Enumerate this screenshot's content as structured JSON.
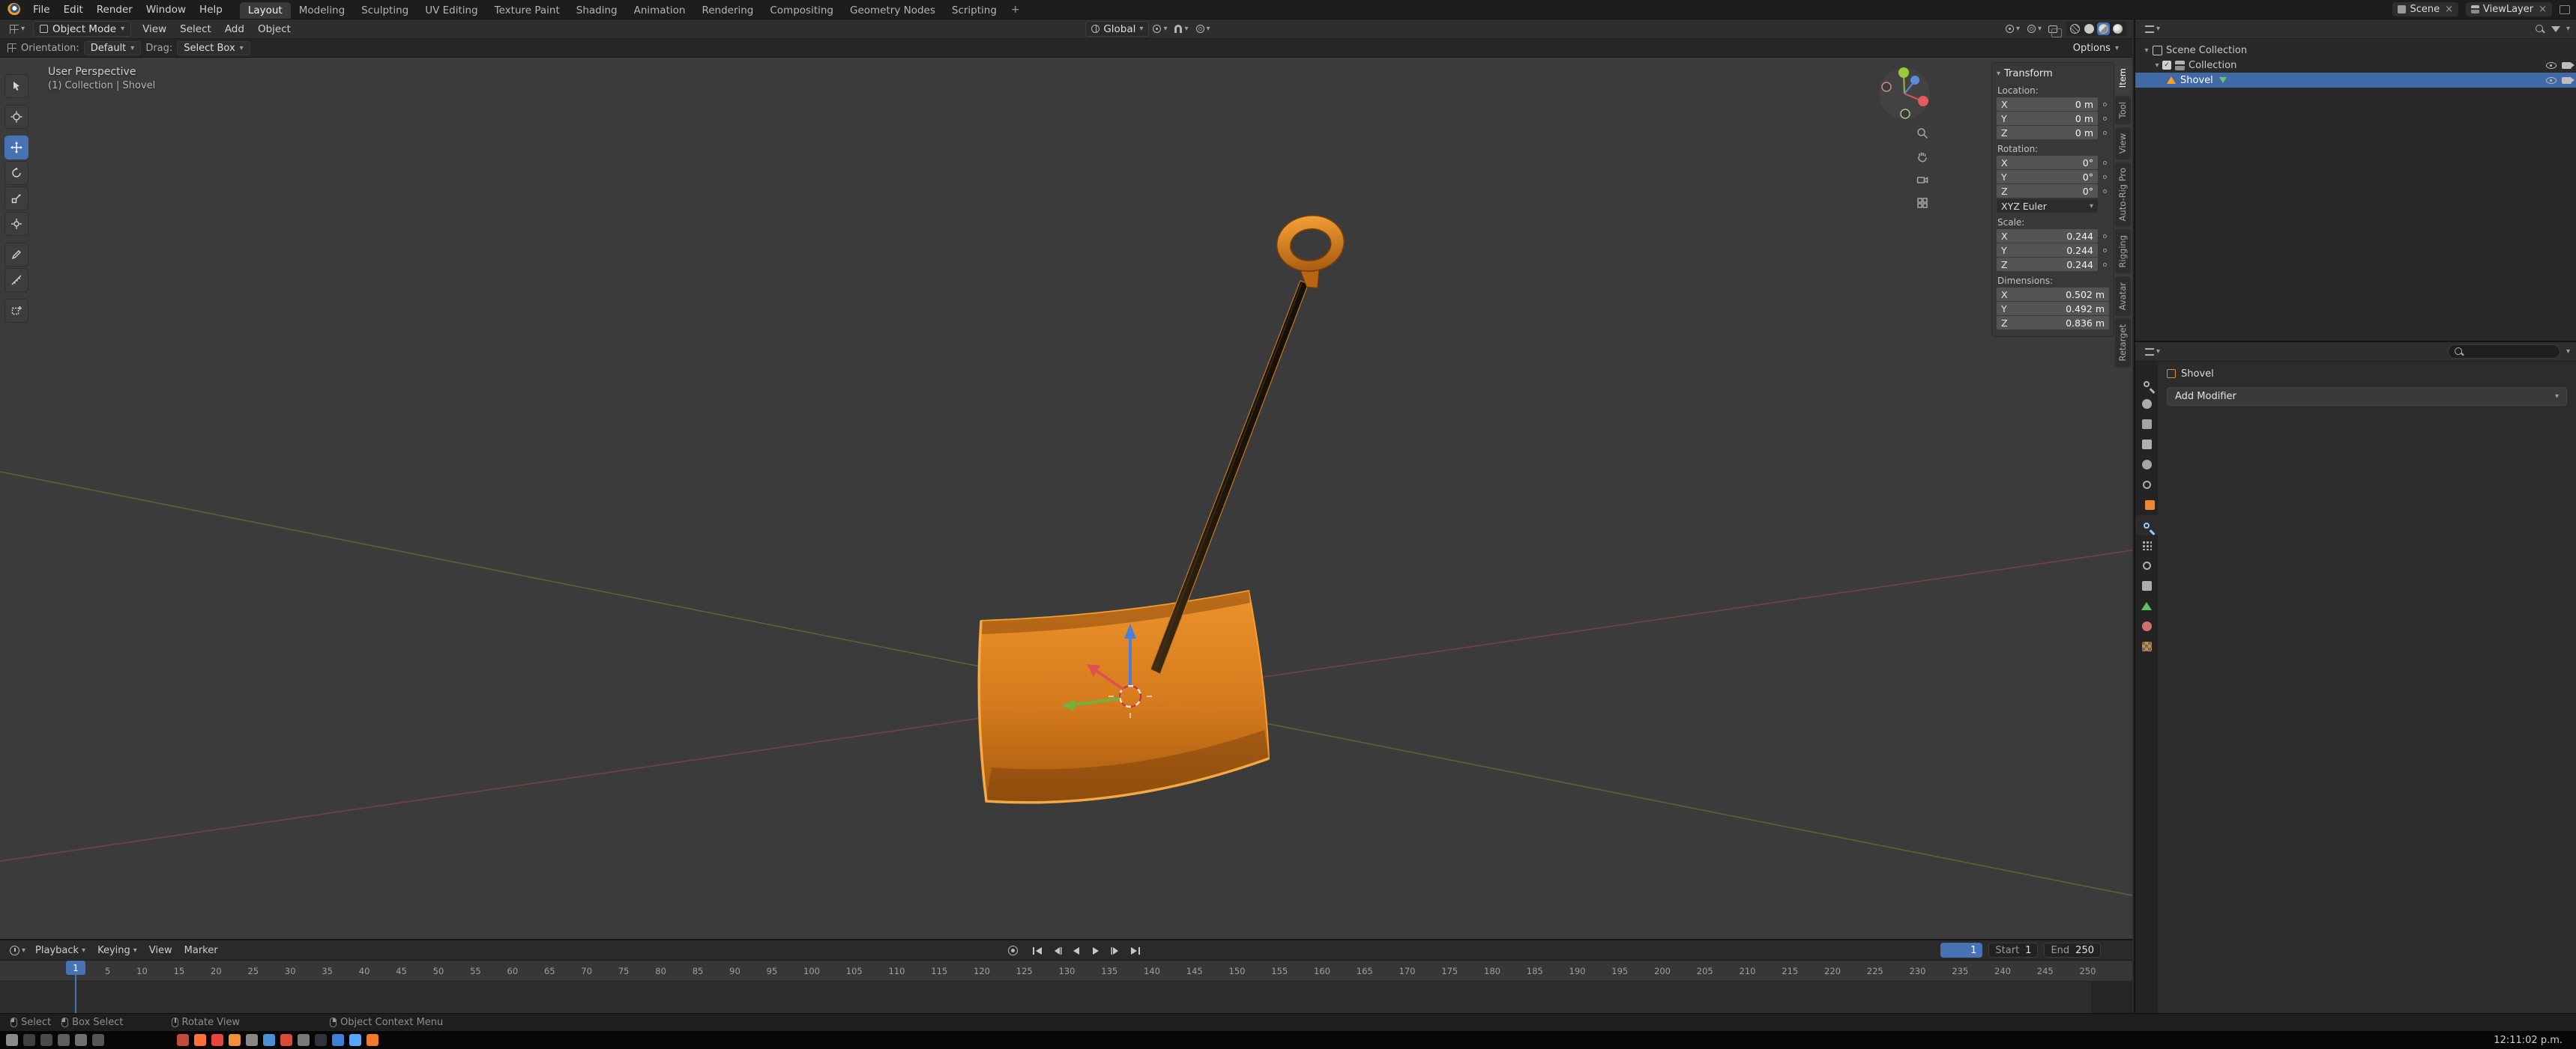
{
  "topbar": {
    "menus": [
      "File",
      "Edit",
      "Render",
      "Window",
      "Help"
    ],
    "workspaces": [
      {
        "label": "Layout",
        "active": true
      },
      {
        "label": "Modeling"
      },
      {
        "label": "Sculpting"
      },
      {
        "label": "UV Editing"
      },
      {
        "label": "Texture Paint"
      },
      {
        "label": "Shading"
      },
      {
        "label": "Animation"
      },
      {
        "label": "Rendering"
      },
      {
        "label": "Compositing"
      },
      {
        "label": "Geometry Nodes"
      },
      {
        "label": "Scripting"
      }
    ],
    "add_workspace": "+",
    "scene": "Scene",
    "view_layer": "ViewLayer"
  },
  "viewport_header": {
    "mode": "Object Mode",
    "menus": [
      "View",
      "Select",
      "Add",
      "Object"
    ],
    "orientation": "Global",
    "shading_modes": [
      "Wireframe",
      "Solid",
      "Material Preview",
      "Rendered"
    ],
    "active_shading": "Material Preview"
  },
  "tool_settings": {
    "orientation_label": "Orientation:",
    "orientation_value": "Default",
    "drag_label": "Drag:",
    "drag_value": "Select Box",
    "options_label": "Options"
  },
  "tools": [
    "Select Box",
    "Cursor",
    "Move",
    "Rotate",
    "Scale",
    "Transform",
    "Annotate",
    "Measure",
    "Add Cube"
  ],
  "active_tool": "Move",
  "viewport": {
    "view_label": "User Perspective",
    "context_label": "(1) Collection | Shovel",
    "accent_orange": "#e8871e",
    "axis_colors": {
      "x": "#e05252",
      "y": "#6fb33c",
      "z": "#4a7fe0"
    }
  },
  "n_panel": {
    "title": "Transform",
    "axes": [
      "X",
      "Y",
      "Z"
    ],
    "tabs": [
      {
        "label": "Item",
        "active": true
      },
      {
        "label": "Tool"
      },
      {
        "label": "View"
      },
      {
        "label": "Auto-Rig Pro"
      },
      {
        "label": "Rigging"
      },
      {
        "label": "Avatar"
      },
      {
        "label": "Retarget"
      }
    ],
    "location": {
      "label": "Location:",
      "x": "0 m",
      "y": "0 m",
      "z": "0 m"
    },
    "rotation": {
      "label": "Rotation:",
      "x": "0°",
      "y": "0°",
      "z": "0°",
      "mode": "XYZ Euler"
    },
    "scale": {
      "label": "Scale:",
      "x": "0.244",
      "y": "0.244",
      "z": "0.244"
    },
    "dimensions": {
      "label": "Dimensions:",
      "x": "0.502 m",
      "y": "0.492 m",
      "z": "0.836 m"
    }
  },
  "outliner": {
    "rows": [
      {
        "label": "Scene Collection"
      },
      {
        "label": "Collection"
      },
      {
        "label": "Shovel",
        "selected": true
      }
    ]
  },
  "properties": {
    "breadcrumb_object": "Shovel",
    "add_modifier_label": "Add Modifier",
    "active_tab": "modifiers",
    "tabs": [
      {
        "name": "tool",
        "shape": "wrench",
        "color": "#b3b3b3"
      },
      {
        "name": "render",
        "shape": "circle",
        "color": "#adadad"
      },
      {
        "name": "output",
        "shape": "square",
        "color": "#a5a5a5"
      },
      {
        "name": "view-layer",
        "shape": "square",
        "color": "#b0b0b0"
      },
      {
        "name": "scene",
        "shape": "circle",
        "color": "#a5a5a5"
      },
      {
        "name": "world",
        "shape": "ring",
        "color": "#adadad"
      },
      {
        "name": "object",
        "shape": "square",
        "color": "#e8883a",
        "gap": 8
      },
      {
        "name": "modifiers",
        "shape": "wrench",
        "color": "#9ecbff",
        "active": true
      },
      {
        "name": "particles",
        "shape": "dots",
        "color": "#b0b0b0"
      },
      {
        "name": "physics",
        "shape": "ring",
        "color": "#b0b0b0"
      },
      {
        "name": "constraints",
        "shape": "square",
        "color": "#adadad"
      },
      {
        "name": "object-data",
        "shape": "triangle",
        "color": "#5fbf5f"
      },
      {
        "name": "material",
        "shape": "circle",
        "color": "#cf7070"
      },
      {
        "name": "texture",
        "shape": "checker",
        "color": "#d08a3a"
      }
    ]
  },
  "timeline": {
    "menus_popover": [
      "Playback",
      "Keying"
    ],
    "menus_plain": [
      "View",
      "Marker"
    ],
    "current_frame": "1",
    "start_label": "Start",
    "start_value": "1",
    "end_label": "End",
    "end_value": "250",
    "frame_labels": [
      5,
      10,
      15,
      20,
      25,
      30,
      35,
      40,
      45,
      50,
      55,
      60,
      65,
      70,
      75,
      80,
      85,
      90,
      95,
      100,
      105,
      110,
      115,
      120,
      125,
      130,
      135,
      140,
      145,
      150,
      155,
      160,
      165,
      170,
      175,
      180,
      185,
      190,
      195,
      200,
      205,
      210,
      215,
      220,
      225,
      230,
      235,
      240,
      245,
      250
    ]
  },
  "status_bar": {
    "items": [
      {
        "label": "Select",
        "mouse": "l",
        "gap": 0
      },
      {
        "label": "Box Select",
        "mouse": "l",
        "gap": 14
      },
      {
        "label": "Rotate View",
        "mouse": "m",
        "gap": 64
      },
      {
        "label": "Object Context Menu",
        "mouse": "r",
        "gap": 120
      }
    ]
  },
  "taskbar": {
    "clock": "12:11:02 p.m.",
    "icons": [
      {
        "name": "app-menu",
        "color": "#8a8a8a"
      },
      {
        "name": "terminal",
        "color": "#3f3f3f"
      },
      {
        "name": "console",
        "color": "#4a4a4a"
      },
      {
        "name": "files",
        "color": "#5f5f5f"
      },
      {
        "name": "settings",
        "color": "#6f6f6f"
      },
      {
        "name": "editor",
        "color": "#555555"
      },
      {
        "name": "app-red",
        "color": "#c24a3a",
        "gap": 90
      },
      {
        "name": "firefox",
        "color": "#ff7139"
      },
      {
        "name": "app-scarlet",
        "color": "#e8453c"
      },
      {
        "name": "app-orange",
        "color": "#f09038"
      },
      {
        "name": "app-gray",
        "color": "#888888"
      },
      {
        "name": "app-blue",
        "color": "#4a90d9"
      },
      {
        "name": "app-crimson",
        "color": "#d94a3a"
      },
      {
        "name": "app-slate",
        "color": "#7a7a7a"
      },
      {
        "name": "app-dark",
        "color": "#30343a"
      },
      {
        "name": "app-azure",
        "color": "#3f7fd9"
      },
      {
        "name": "app-sky",
        "color": "#58a6ff"
      },
      {
        "name": "blender",
        "color": "#f5792a"
      }
    ]
  }
}
